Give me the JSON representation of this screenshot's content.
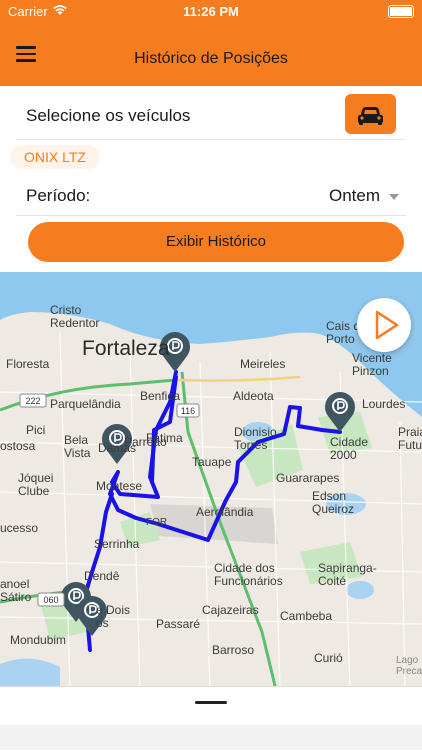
{
  "status_bar": {
    "carrier": "Carrier",
    "time": "11:26 PM"
  },
  "header": {
    "title": "Histórico de Posições",
    "menu_icon": "hamburger-menu-icon"
  },
  "vehicle_select": {
    "label": "Selecione os veículos",
    "button_icon": "car-icon"
  },
  "selected_vehicles": [
    "ONIX LTZ"
  ],
  "period": {
    "label": "Período:",
    "value": "Ontem"
  },
  "action_button": "Exibir Histórico",
  "map": {
    "labels": {
      "cristo_redentor": "Cristo\nRedentor",
      "fortaleza": "Fortaleza",
      "floresta": "Floresta",
      "parquelandia": "Parquelândia",
      "benfica": "Benfica",
      "meireles": "Meireles",
      "aldeota": "Aldeota",
      "cais": "Cais d\nPorto",
      "vicente": "Vicente\nPinzon",
      "lourdes": "Lourdes",
      "praia": "Praia\nFutur",
      "pici": "Pici",
      "bela_vista": "Bela\nVista",
      "damas": "Damas",
      "fatima": "Fátima",
      "dionisio": "Dionisio\nTorres",
      "cidade2000": "Cidade\n2000",
      "ostosa": "ostosa",
      "joquei": "Jóquei\nClube",
      "parreao": "Parreão",
      "tauape": "Tauape",
      "guararapes": "Guararapes",
      "edson": "Edson\nQueiroz",
      "montese": "Montese",
      "ucesso": "ucesso",
      "for_airport": "FOR",
      "aerolandia": "Aerolândia",
      "serrinha": "Serrinha",
      "dende": "Dendê",
      "sapiranga": "Sapiranga-\nCoité",
      "cidade_func": "Cidade dos\nFuncionários",
      "anoel": "anoel\nSátiro",
      "dois": "e Dois\nos",
      "cajazeiras": "Cajazeiras",
      "cambeba": "Cambeba",
      "passare": "Passaré",
      "mondubim": "Mondubim",
      "barroso": "Barroso",
      "curio": "Curió",
      "lagoa": "Lago\nPreca",
      "road_222": "222",
      "road_116": "116",
      "road_060": "060"
    },
    "markers_icon": "parking-marker-icon",
    "play_icon": "play-icon"
  },
  "colors": {
    "accent": "#f57c1f",
    "route": "#1a12e6",
    "marker": "#3f5660",
    "water": "#8fc8ef",
    "park": "#c6e7c0"
  }
}
